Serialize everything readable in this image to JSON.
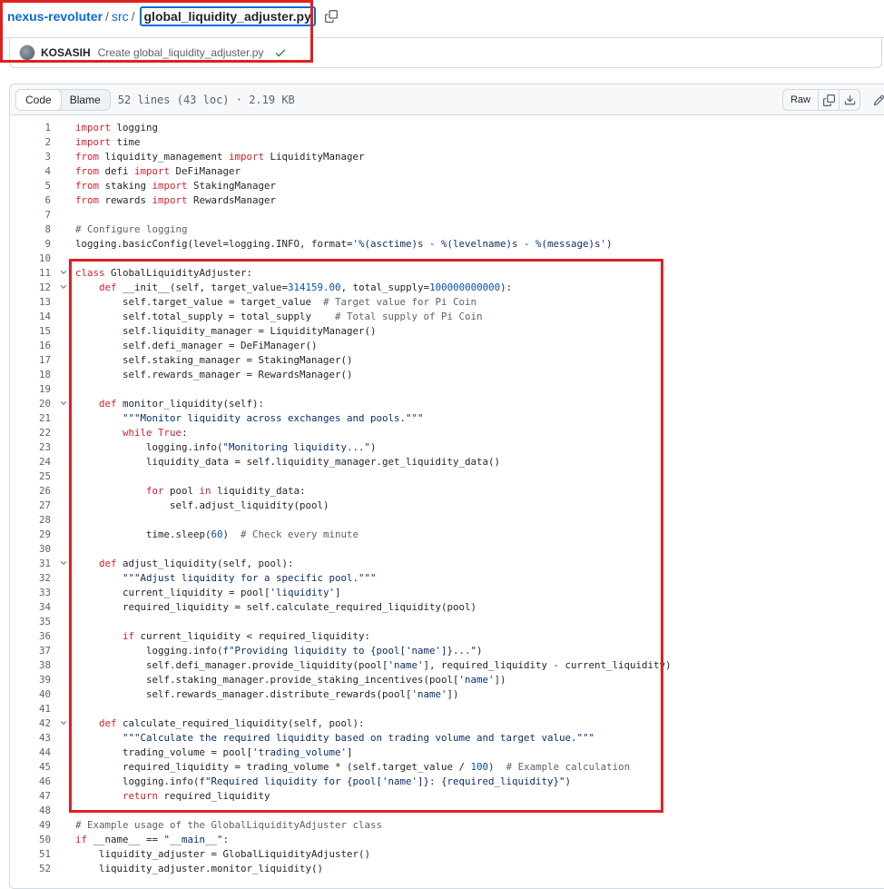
{
  "breadcrumb": {
    "repo": "nexus-revoluter",
    "separator": "/",
    "dir": "src",
    "file": "global_liquidity_adjuster.py"
  },
  "commit": {
    "author": "KOSASIH",
    "message": "Create global_liquidity_adjuster.py"
  },
  "file_header": {
    "tab_code": "Code",
    "tab_blame": "Blame",
    "info": "52 lines (43 loc) · 2.19 KB",
    "raw_label": "Raw"
  },
  "icons": {
    "copy_path": "copy-icon",
    "commit_status": "check-icon",
    "copy_raw": "copy-icon",
    "download": "download-icon",
    "edit": "pencil-icon",
    "fold": "chevron-down-icon"
  },
  "colors": {
    "link": "#0969da",
    "highlight_box": "#e02020",
    "success": "#1a7f37",
    "keyword": "#cf222e",
    "entity": "#6639ba",
    "string": "#0a3069",
    "comment": "#59636e",
    "constant": "#0550ae"
  },
  "code_lines": [
    "import logging",
    "import time",
    "from liquidity_management import LiquidityManager",
    "from defi import DeFiManager",
    "from staking import StakingManager",
    "from rewards import RewardsManager",
    "",
    "# Configure logging",
    "logging.basicConfig(level=logging.INFO, format='%(asctime)s - %(levelname)s - %(message)s')",
    "",
    "class GlobalLiquidityAdjuster:",
    "    def __init__(self, target_value=314159.00, total_supply=100000000000):",
    "        self.target_value = target_value  # Target value for Pi Coin",
    "        self.total_supply = total_supply    # Total supply of Pi Coin",
    "        self.liquidity_manager = LiquidityManager()",
    "        self.defi_manager = DeFiManager()",
    "        self.staking_manager = StakingManager()",
    "        self.rewards_manager = RewardsManager()",
    "",
    "    def monitor_liquidity(self):",
    "        \"\"\"Monitor liquidity across exchanges and pools.\"\"\"",
    "        while True:",
    "            logging.info(\"Monitoring liquidity...\")",
    "            liquidity_data = self.liquidity_manager.get_liquidity_data()",
    "",
    "            for pool in liquidity_data:",
    "                self.adjust_liquidity(pool)",
    "",
    "            time.sleep(60)  # Check every minute",
    "",
    "    def adjust_liquidity(self, pool):",
    "        \"\"\"Adjust liquidity for a specific pool.\"\"\"",
    "        current_liquidity = pool['liquidity']",
    "        required_liquidity = self.calculate_required_liquidity(pool)",
    "",
    "        if current_liquidity < required_liquidity:",
    "            logging.info(f\"Providing liquidity to {pool['name']}...\")",
    "            self.defi_manager.provide_liquidity(pool['name'], required_liquidity - current_liquidity)",
    "            self.staking_manager.provide_staking_incentives(pool['name'])",
    "            self.rewards_manager.distribute_rewards(pool['name'])",
    "",
    "    def calculate_required_liquidity(self, pool):",
    "        \"\"\"Calculate the required liquidity based on trading volume and target value.\"\"\"",
    "        trading_volume = pool['trading_volume']",
    "        required_liquidity = trading_volume * (self.target_value / 100)  # Example calculation",
    "        logging.info(f\"Required liquidity for {pool['name']}: {required_liquidity}\")",
    "        return required_liquidity",
    "",
    "# Example usage of the GlobalLiquidityAdjuster class",
    "if __name__ == \"__main__\":",
    "    liquidity_adjuster = GlobalLiquidityAdjuster()",
    "    liquidity_adjuster.monitor_liquidity()"
  ],
  "fold_lines": [
    11,
    12,
    20,
    31,
    42
  ]
}
